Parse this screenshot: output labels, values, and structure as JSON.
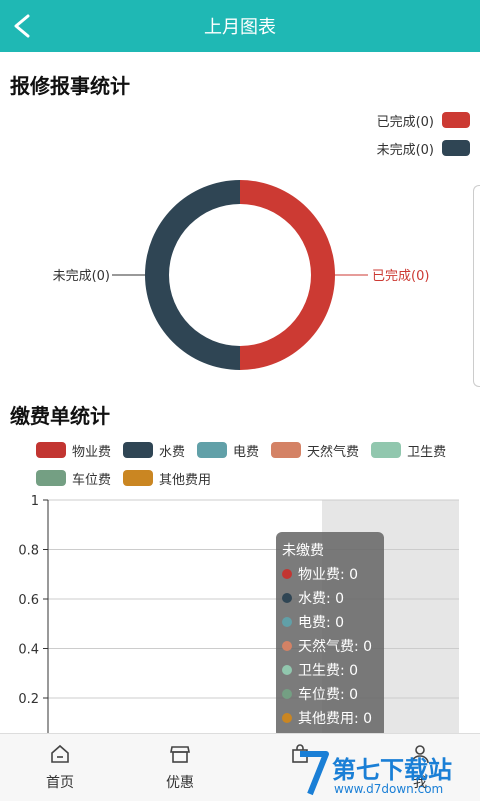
{
  "header": {
    "title": "上月图表"
  },
  "repair_section": {
    "title": "报修报事统计",
    "legend": [
      {
        "label": "已完成(0)",
        "color": "#cc3a33"
      },
      {
        "label": "未完成(0)",
        "color": "#2f4554"
      }
    ],
    "callouts": {
      "left": "未完成(0)",
      "right": "已完成(0)"
    }
  },
  "fee_section": {
    "title": "缴费单统计",
    "legend": [
      {
        "label": "物业费",
        "color": "#c23531"
      },
      {
        "label": "水费",
        "color": "#2f4554"
      },
      {
        "label": "电费",
        "color": "#61a0a8"
      },
      {
        "label": "天然气费",
        "color": "#d48265"
      },
      {
        "label": "卫生费",
        "color": "#91c7ae"
      },
      {
        "label": "车位费",
        "color": "#749f83"
      },
      {
        "label": "其他费用",
        "color": "#ca8622"
      }
    ],
    "tooltip": {
      "title": "未缴费",
      "rows": [
        {
          "label": "物业费: 0",
          "color": "#c23531"
        },
        {
          "label": "水费: 0",
          "color": "#2f4554"
        },
        {
          "label": "电费: 0",
          "color": "#61a0a8"
        },
        {
          "label": "天然气费: 0",
          "color": "#d48265"
        },
        {
          "label": "卫生费: 0",
          "color": "#91c7ae"
        },
        {
          "label": "车位费: 0",
          "color": "#749f83"
        },
        {
          "label": "其他费用: 0",
          "color": "#ca8622"
        }
      ]
    }
  },
  "chart_data": [
    {
      "type": "pie",
      "title": "报修报事统计",
      "categories": [
        "已完成",
        "未完成"
      ],
      "values": [
        0,
        0
      ],
      "colors": [
        "#cc3a33",
        "#2f4554"
      ],
      "legend": "top-right"
    },
    {
      "type": "bar",
      "title": "缴费单统计",
      "categories": [
        "未缴费"
      ],
      "series": [
        {
          "name": "物业费",
          "values": [
            0
          ]
        },
        {
          "name": "水费",
          "values": [
            0
          ]
        },
        {
          "name": "电费",
          "values": [
            0
          ]
        },
        {
          "name": "天然气费",
          "values": [
            0
          ]
        },
        {
          "name": "卫生费",
          "values": [
            0
          ]
        },
        {
          "name": "车位费",
          "values": [
            0
          ]
        },
        {
          "name": "其他费用",
          "values": [
            0
          ]
        }
      ],
      "ylim": [
        0,
        1
      ],
      "yticks": [
        "1",
        "0.8",
        "0.6",
        "0.4",
        "0.2"
      ],
      "grid": true
    }
  ],
  "tabbar": {
    "items": [
      {
        "label": "首页",
        "icon": "home-icon"
      },
      {
        "label": "优惠",
        "icon": "store-icon"
      },
      {
        "label": "",
        "icon": "bag-icon"
      },
      {
        "label": "我",
        "icon": "person-icon"
      }
    ]
  },
  "watermark": {
    "title": "第七下载站",
    "url": "www.d7down.com"
  }
}
